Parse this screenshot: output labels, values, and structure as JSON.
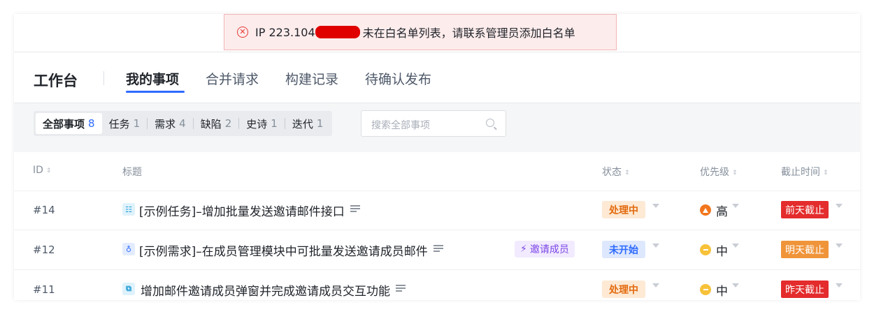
{
  "alert": {
    "icon": "close-circle-icon",
    "prefix": "IP 223.104",
    "message": "未在白名单列表，请联系管理员添加白名单",
    "color": "#e53935"
  },
  "nav": {
    "title": "工作台",
    "tabs": [
      "我的事项",
      "合并请求",
      "构建记录",
      "待确认发布"
    ],
    "active_tab": "我的事项",
    "accent": "#2f6bff"
  },
  "filters": {
    "items": [
      {
        "label": "全部事项",
        "count": "8"
      },
      {
        "label": "任务",
        "count": "1"
      },
      {
        "label": "需求",
        "count": "4"
      },
      {
        "label": "缺陷",
        "count": "2"
      },
      {
        "label": "史诗",
        "count": "1"
      },
      {
        "label": "迭代",
        "count": "1"
      }
    ],
    "search_placeholder": "搜索全部事项"
  },
  "table": {
    "columns": {
      "id": "ID",
      "title": "标题",
      "status": "状态",
      "priority": "优先级",
      "deadline": "截止时间"
    },
    "rows": [
      {
        "id": "#14",
        "type_icon": "task-icon",
        "title": "[示例任务]–增加批量发送邀请邮件接口",
        "tag": "",
        "status": "处理中",
        "priority": "高",
        "deadline": "前天截止"
      },
      {
        "id": "#12",
        "type_icon": "requirement-icon",
        "title": "[示例需求]–在成员管理模块中可批量发送邀请成员邮件",
        "tag": "邀请成员",
        "status": "未开始",
        "priority": "中",
        "deadline": "明天截止"
      },
      {
        "id": "#11",
        "type_icon": "subtask-icon",
        "title": "增加邮件邀请成员弹窗并完成邀请成员交互功能",
        "tag": "",
        "status": "处理中",
        "priority": "中",
        "deadline": "昨天截止"
      }
    ]
  },
  "colors": {
    "status_processing_bg": "#fde9d4",
    "status_processing_fg": "#e36a0e",
    "status_notstarted_bg": "#dde8ff",
    "status_notstarted_fg": "#2f6bff",
    "priority_high": "#f2761c",
    "priority_mid": "#f7c23a",
    "due_red": "#e42c2c",
    "due_orange": "#f0943a"
  }
}
